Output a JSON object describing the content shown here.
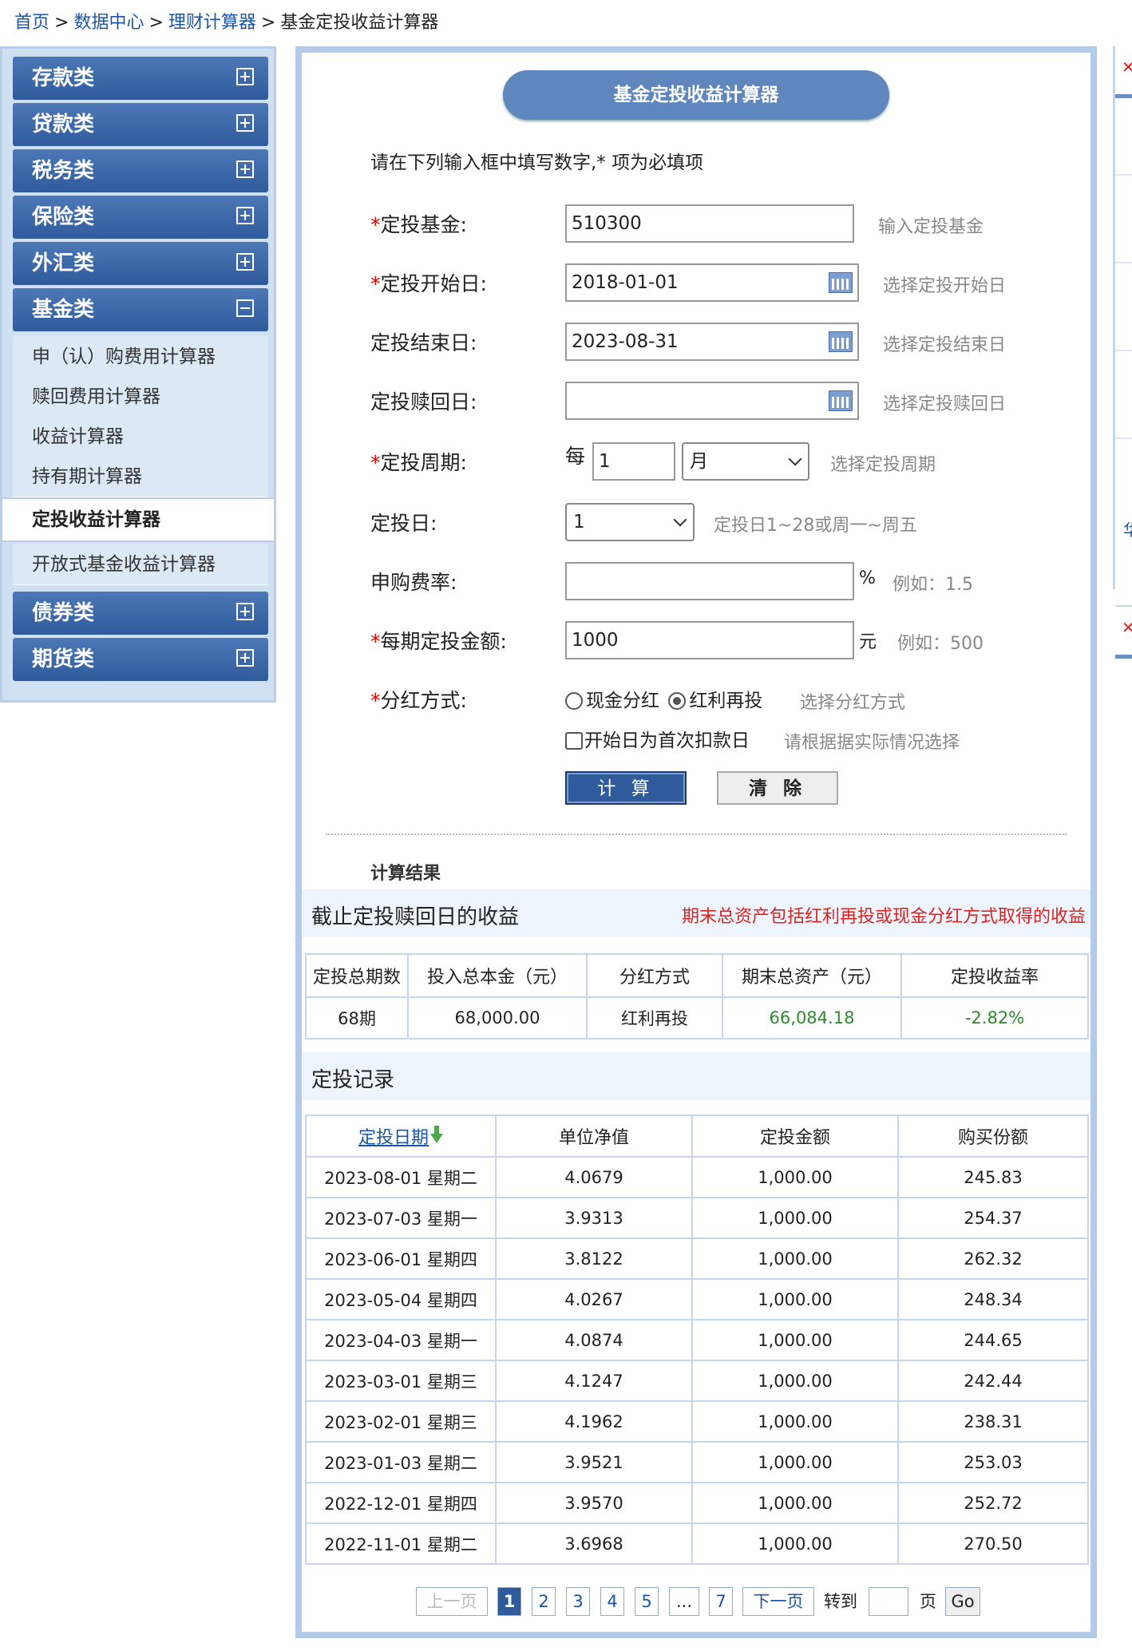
{
  "breadcrumb": {
    "home": "首页",
    "data_center": "数据中心",
    "calculator": "理财计算器",
    "current": "基金定投收益计算器",
    "sep": ">"
  },
  "sidebar": {
    "categories": [
      {
        "label": "存款类"
      },
      {
        "label": "贷款类"
      },
      {
        "label": "税务类"
      },
      {
        "label": "保险类"
      },
      {
        "label": "外汇类"
      },
      {
        "label": "基金类"
      }
    ],
    "fund_items": [
      "申（认）购费用计算器",
      "赎回费用计算器",
      "收益计算器",
      "持有期计算器",
      "定投收益计算器",
      "开放式基金收益计算器"
    ],
    "bottom_categories": [
      {
        "label": "债券类"
      },
      {
        "label": "期货类"
      }
    ]
  },
  "form": {
    "title": "基金定投收益计算器",
    "instruction": "请在下列输入框中填写数字,* 项为必填项",
    "req": "*",
    "fund_label": "定投基金:",
    "fund_value": "510300",
    "fund_hint": "输入定投基金",
    "start_label": "定投开始日:",
    "start_value": "2018-01-01",
    "start_hint": "选择定投开始日",
    "end_label": "定投结束日:",
    "end_value": "2023-08-31",
    "end_hint": "选择定投结束日",
    "redeem_label": "定投赎回日:",
    "redeem_value": "",
    "redeem_hint": "选择定投赎回日",
    "period_label": "定投周期:",
    "period_prefix": "每",
    "period_value": "1",
    "period_unit": "月",
    "period_hint": "选择定投周期",
    "day_label": "定投日:",
    "day_value": "1",
    "day_hint": "定投日1~28或周一~周五",
    "fee_label": "申购费率:",
    "fee_unit": "%",
    "fee_hint": "例如：1.5",
    "amount_label": "每期定投金额:",
    "amount_value": "1000",
    "amount_unit": "元",
    "amount_hint": "例如：500",
    "dividend_label": "分红方式:",
    "dividend_cash": "现金分红",
    "dividend_reinvest": "红利再投",
    "dividend_hint": "选择分红方式",
    "first_label": "开始日为首次扣款日",
    "first_hint": "请根据据实际情况选择",
    "calc_btn": "计 算",
    "clear_btn": "清 除"
  },
  "result": {
    "section": "计算结果",
    "bar_title": "截止定投赎回日的收益",
    "bar_note": "期末总资产包括红利再投或现金分红方式取得的收益",
    "headers": [
      "定投总期数",
      "投入总本金（元）",
      "分红方式",
      "期末总资产（元）",
      "定投收益率"
    ],
    "row": [
      "68期",
      "68,000.00",
      "红利再投",
      "66,084.18",
      "-2.82%"
    ],
    "colors": {
      "positive": "#2c8a2c"
    }
  },
  "records": {
    "title": "定投记录",
    "headers": [
      "定投日期",
      "单位净值",
      "定投金额",
      "购买份额"
    ],
    "rows": [
      [
        "2023-08-01 星期二",
        "4.0679",
        "1,000.00",
        "245.83"
      ],
      [
        "2023-07-03 星期一",
        "3.9313",
        "1,000.00",
        "254.37"
      ],
      [
        "2023-06-01 星期四",
        "3.8122",
        "1,000.00",
        "262.32"
      ],
      [
        "2023-05-04 星期四",
        "4.0267",
        "1,000.00",
        "248.34"
      ],
      [
        "2023-04-03 星期一",
        "4.0874",
        "1,000.00",
        "244.65"
      ],
      [
        "2023-03-01 星期三",
        "4.1247",
        "1,000.00",
        "242.44"
      ],
      [
        "2023-02-01 星期三",
        "4.1962",
        "1,000.00",
        "238.31"
      ],
      [
        "2023-01-03 星期二",
        "3.9521",
        "1,000.00",
        "253.03"
      ],
      [
        "2022-12-01 星期四",
        "3.9570",
        "1,000.00",
        "252.72"
      ],
      [
        "2022-11-01 星期二",
        "3.6968",
        "1,000.00",
        "270.50"
      ]
    ]
  },
  "pager": {
    "prev": "上一页",
    "pages": [
      "1",
      "2",
      "3",
      "4",
      "5",
      "...",
      "7"
    ],
    "next": "下一页",
    "goto": "转到",
    "page_unit": "页",
    "go": "Go"
  },
  "rightstrip": {
    "mark1": "✕",
    "mark2": "✕",
    "mark3": "华"
  }
}
